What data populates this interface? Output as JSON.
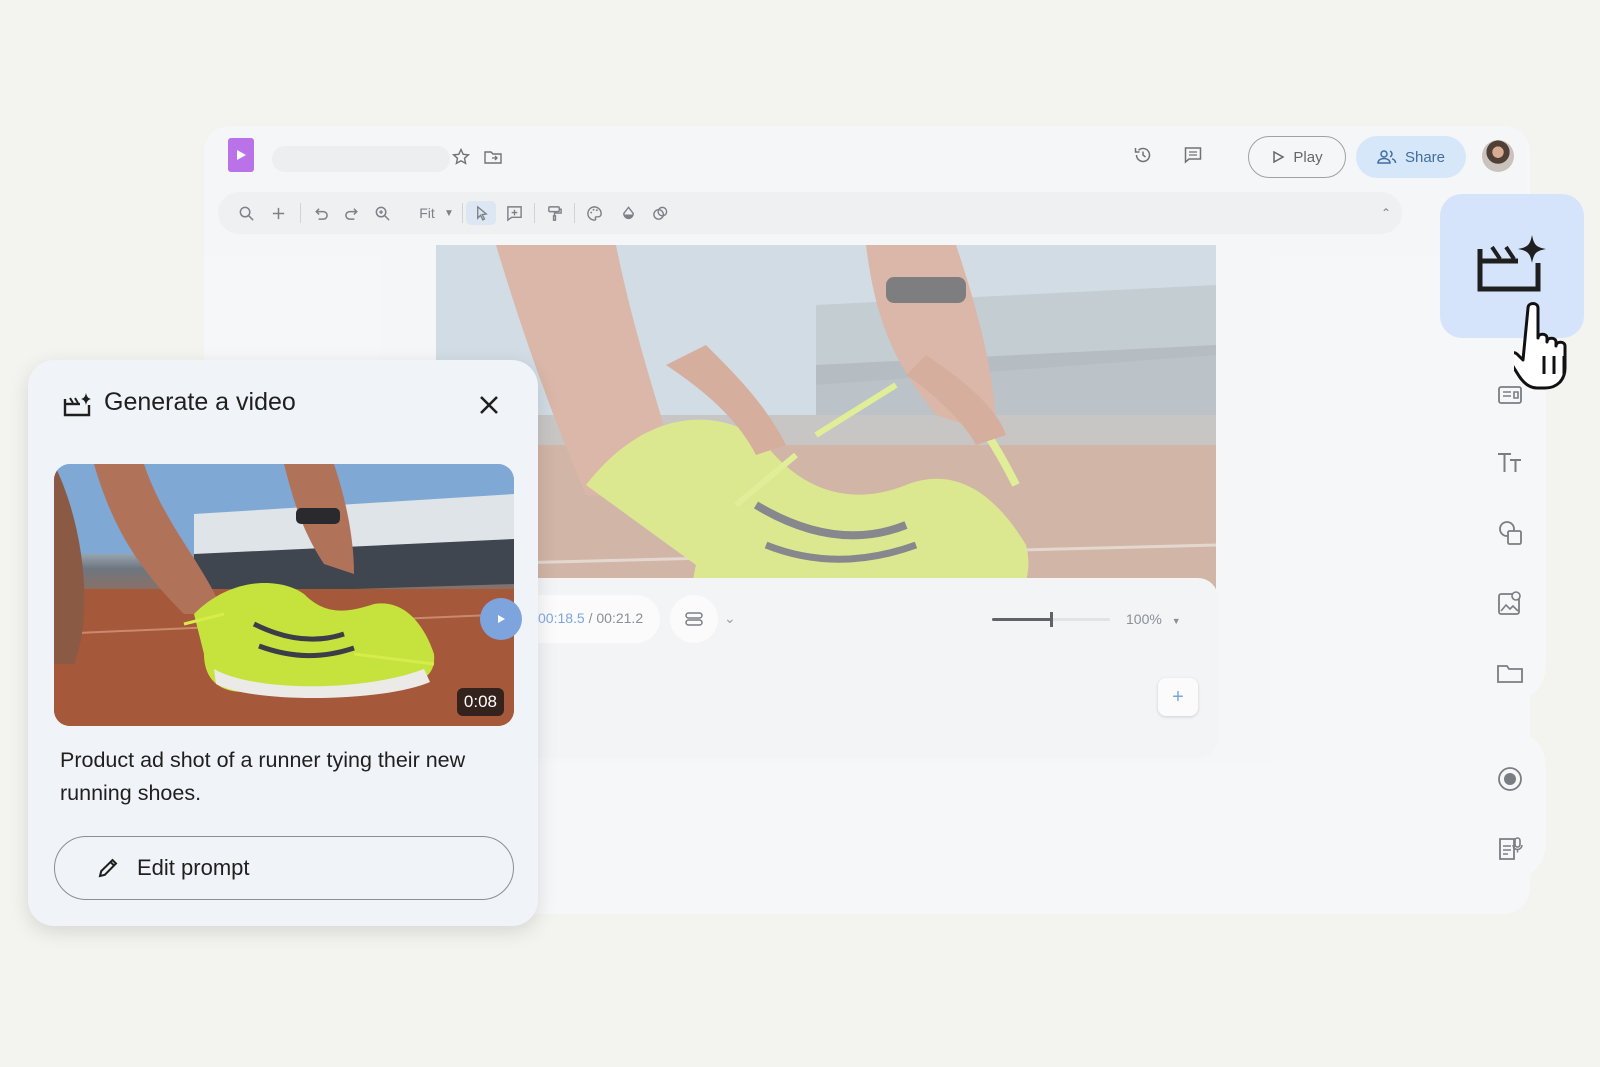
{
  "topbar": {
    "play_label": "Play",
    "share_label": "Share",
    "icons": [
      "slides-logo-icon",
      "star-icon",
      "move-to-folder-icon",
      "version-history-icon",
      "comments-icon",
      "play-icon",
      "people-icon",
      "avatar"
    ]
  },
  "toolbar": {
    "zoom_label": "Fit",
    "icons": [
      "search-icon",
      "add-icon",
      "undo-icon",
      "redo-icon",
      "zoom-icon",
      "select-icon",
      "comment-add-icon",
      "paint-format-icon",
      "palette-icon",
      "fill-icon",
      "mask-icon",
      "collapse-icon"
    ]
  },
  "player": {
    "current_time": "00:18.5",
    "separator": " / ",
    "total_time": "00:21.2",
    "volume_level": 0.5,
    "zoom_percent": "100%",
    "add_label": "+"
  },
  "side_rail": {
    "icons": [
      "generate-video-icon",
      "text-box-icon",
      "text-format-icon",
      "shapes-icon",
      "image-icon",
      "folder-icon",
      "record-icon",
      "voiceover-script-icon"
    ]
  },
  "panel": {
    "title": "Generate a video",
    "duration": "0:08",
    "prompt": "Product ad shot of a runner tying their new running shoes.",
    "edit_label": "Edit prompt"
  },
  "colors": {
    "accent": "#7ea4de",
    "share_bg": "#d6e7fa",
    "generate_tile": "#d6e4fb",
    "logo": "#b96ee8"
  }
}
